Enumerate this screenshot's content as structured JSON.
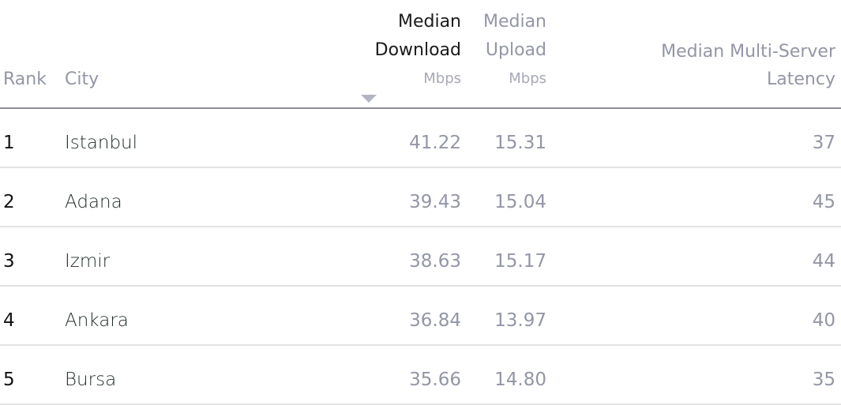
{
  "table": {
    "headers": {
      "rank": "Rank",
      "city": "City",
      "download": {
        "line1": "Median",
        "line2": "Download",
        "unit": "Mbps"
      },
      "upload": {
        "line1": "Median",
        "line2": "Upload",
        "unit": "Mbps"
      },
      "latency": {
        "line1": "Median Multi-Server",
        "line2": "Latency"
      }
    },
    "sort": {
      "column": "download",
      "direction": "descending",
      "icon": "sort-down-triangle-icon"
    },
    "rows": [
      {
        "rank": "1",
        "city": "Istanbul",
        "download": "41.22",
        "upload": "15.31",
        "latency": "37"
      },
      {
        "rank": "2",
        "city": "Adana",
        "download": "39.43",
        "upload": "15.04",
        "latency": "45"
      },
      {
        "rank": "3",
        "city": "Izmir",
        "download": "38.63",
        "upload": "15.17",
        "latency": "44"
      },
      {
        "rank": "4",
        "city": "Ankara",
        "download": "36.84",
        "upload": "13.97",
        "latency": "40"
      },
      {
        "rank": "5",
        "city": "Bursa",
        "download": "35.66",
        "upload": "14.80",
        "latency": "35"
      }
    ]
  }
}
